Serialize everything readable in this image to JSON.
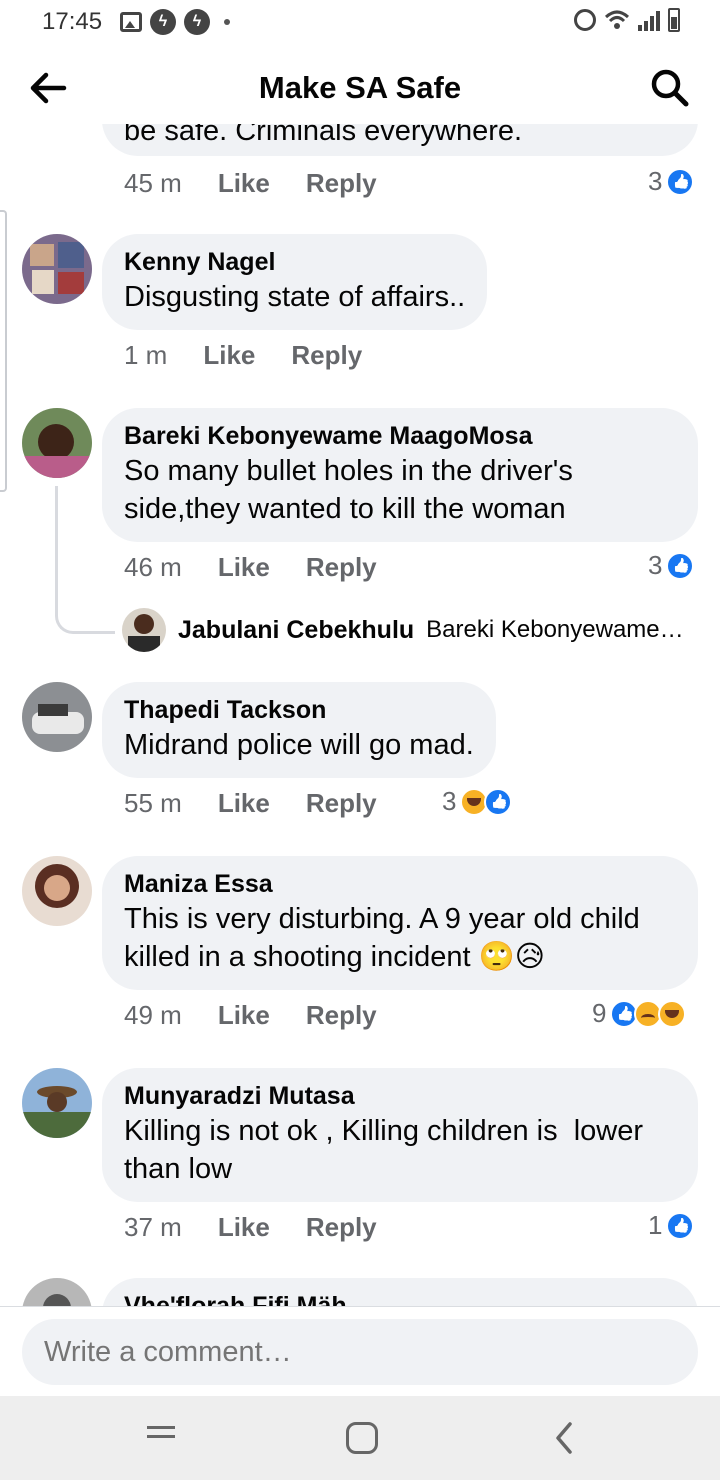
{
  "status_bar": {
    "time": "17:45"
  },
  "header": {
    "title": "Make SA Safe"
  },
  "comments": [
    {
      "author": "",
      "text": "be safe. Criminals everywhere.",
      "time": "45 m",
      "like": "Like",
      "reply": "Reply",
      "reaction_count": "3"
    },
    {
      "author": "Kenny Nagel",
      "text": "Disgusting state of affairs..",
      "time": "1 m",
      "like": "Like",
      "reply": "Reply",
      "reaction_count": ""
    },
    {
      "author": "Bareki Kebonyewame MaagoMosa",
      "text": "So many bullet holes in the driver's side,they wanted to kill the woman",
      "time": "46 m",
      "like": "Like",
      "reply": "Reply",
      "reaction_count": "3",
      "reply_preview": {
        "author": "Jabulani Cebekhulu",
        "text": "Bareki Kebonyewame…"
      }
    },
    {
      "author": "Thapedi Tackson",
      "text": "Midrand police will go mad.",
      "time": "55 m",
      "like": "Like",
      "reply": "Reply",
      "reaction_count": "3"
    },
    {
      "author": "Maniza Essa",
      "text": "This is very disturbing. A 9 year old child killed in a shooting incident 🙄😥",
      "time": "49 m",
      "like": "Like",
      "reply": "Reply",
      "reaction_count": "9"
    },
    {
      "author": "Munyaradzi Mutasa",
      "text": "Killing is not ok , Killing children is  lower than low",
      "time": "37 m",
      "like": "Like",
      "reply": "Reply",
      "reaction_count": "1"
    },
    {
      "author": "Vhe'florah Fifi Mäh",
      "text": "",
      "time": "",
      "like": "",
      "reply": "",
      "reaction_count": ""
    }
  ],
  "composer": {
    "placeholder": "Write a comment…"
  },
  "icons": {
    "back": "arrow-left-icon",
    "search": "search-icon",
    "like_reaction": "like-reaction-icon",
    "haha_reaction": "haha-reaction-icon",
    "sad_reaction": "sad-reaction-icon"
  },
  "colors": {
    "bubble": "#f0f2f5",
    "meta_text": "#65676b",
    "like_blue": "#1877f2",
    "emoji_yellow": "#f7b125"
  }
}
